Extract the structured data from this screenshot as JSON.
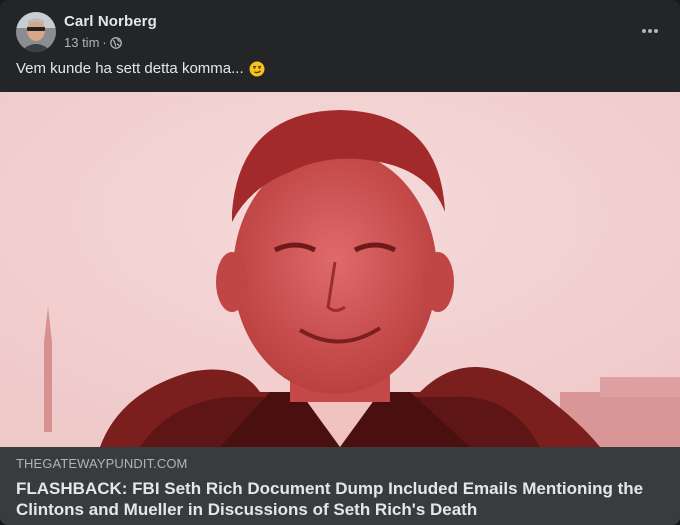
{
  "post": {
    "author": "Carl Norberg",
    "time": "13 tim",
    "separator": "·",
    "privacy_icon": "globe-icon",
    "more_icon": "more-options-icon",
    "caption": "Vem kunde ha sett detta komma...",
    "caption_emoji": "smirk-emoji-icon"
  },
  "link_preview": {
    "domain": "THEGATEWAYPUNDIT.COM",
    "headline": "FLASHBACK: FBI Seth Rich Document Dump Included Emails Mentioning the Clintons and Mueller in Discussions of Seth Rich's Death"
  },
  "colors": {
    "card_bg": "#242526",
    "link_bg": "#3a3b3c",
    "text_primary": "#e4e6eb",
    "text_secondary": "#b0b3b8",
    "photo_tint": "#c24a4a"
  }
}
